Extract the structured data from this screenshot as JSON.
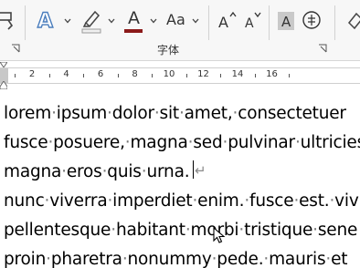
{
  "ribbon": {
    "group_label": "字体",
    "font_size_sample": "Aa",
    "font_color_letter": "A",
    "colors": {
      "font_color_bar": "#8b1a1a",
      "highlight_bar": "#f0f0f0",
      "text_effect": "#4a7dbd"
    },
    "icons": [
      "format-painter-icon",
      "text-effects-icon",
      "highlighter-icon",
      "font-color-icon",
      "change-case-icon",
      "grow-font-icon",
      "shrink-font-icon",
      "character-shading-icon",
      "enclose-characters-icon",
      "eraser-icon"
    ]
  },
  "ruler": {
    "numbers": [
      "2",
      "4",
      "6",
      "8",
      "10",
      "12",
      "14",
      "16"
    ]
  },
  "document": {
    "lines": [
      "lorem ipsum dolor sit amet, consectetuer",
      "fusce posuere, magna sed pulvinar ultricies",
      "magna eros quis urna.",
      "nunc viverra imperdiet enim. fusce est. viv",
      "pellentesque habitant morbi tristique sene",
      "proin pharetra nonummy pede. mauris et"
    ]
  }
}
